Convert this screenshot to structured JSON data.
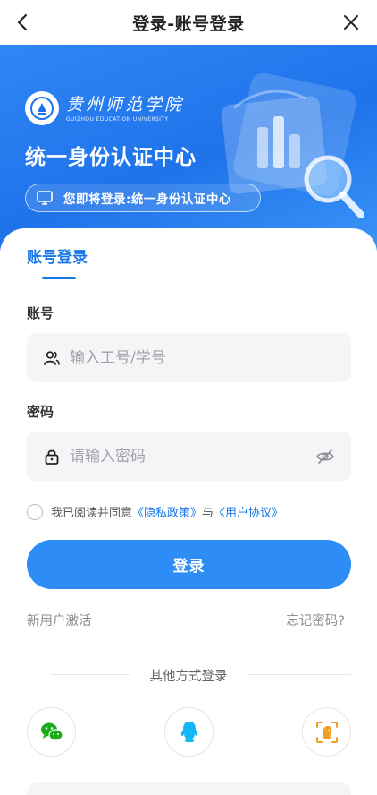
{
  "nav": {
    "title": "登录-账号登录",
    "back_icon": "chevron-left-icon",
    "close_icon": "close-icon"
  },
  "banner": {
    "logo_cn": "贵州师范学院",
    "logo_en": "GUIZHOU EDUCATION UNIVERSITY",
    "title": "统一身份认证中心",
    "pill_text": "您即将登录:统一身份认证中心",
    "pill_icon": "monitor-icon"
  },
  "tabs": {
    "active": "账号登录"
  },
  "account": {
    "label": "账号",
    "placeholder": "输入工号/学号",
    "icon": "users-icon",
    "value": ""
  },
  "password": {
    "label": "密码",
    "placeholder": "请输入密码",
    "icon": "lock-icon",
    "toggle_icon": "eye-off-icon",
    "value": ""
  },
  "agreement": {
    "prefix": "我已阅读并同意",
    "privacy": "《隐私政策》",
    "and": "与",
    "terms": "《用户协议》",
    "checked": false
  },
  "login_button": "登录",
  "links": {
    "activate": "新用户激活",
    "forgot": "忘记密码?"
  },
  "other_login": {
    "title": "其他方式登录",
    "options": [
      "wechat-icon",
      "qq-icon",
      "face-id-icon"
    ]
  },
  "colors": {
    "primary": "#2d8cf5",
    "link": "#1a78e6",
    "banner": "#1f73ea",
    "wechat": "#1aad19",
    "qq": "#12b7f5",
    "face": "#f0a020"
  }
}
